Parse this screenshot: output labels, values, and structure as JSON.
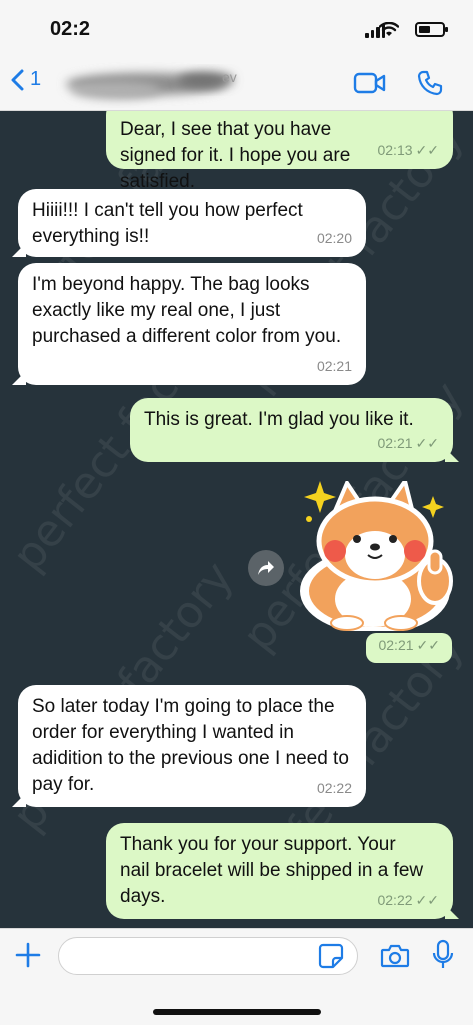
{
  "status": {
    "time": "02:2"
  },
  "nav": {
    "back_count": "1",
    "contact_name_fragment": "ev"
  },
  "watermark": "perfect factory",
  "messages": [
    {
      "dir": "out",
      "text": "Dear, I see that you have signed for it. I hope you are satisfied.",
      "time": "02:13"
    },
    {
      "dir": "in",
      "text": "Hiiii!!! I can't tell you how perfect everything is!!",
      "time": "02:20"
    },
    {
      "dir": "in",
      "text": "I'm beyond happy. The bag looks exactly like my real one, I just purchased a different color from you.",
      "time": "02:21"
    },
    {
      "dir": "out",
      "text": "This is great. I'm glad you like it.",
      "time": "02:21"
    },
    {
      "dir": "out",
      "text": "",
      "time": "02:21"
    },
    {
      "dir": "in",
      "text": "So later today I'm going to place the order for everything I wanted in adidition to the previous one I need to pay for.",
      "time": "02:22"
    },
    {
      "dir": "out",
      "text": "Thank you for your support. Your nail bracelet will be shipped in a few days.",
      "time": "02:22"
    }
  ],
  "colors": {
    "accent": "#1e7ce6",
    "outgoing": "#dcf8c6",
    "incoming": "#ffffff",
    "background": "#26333b"
  }
}
